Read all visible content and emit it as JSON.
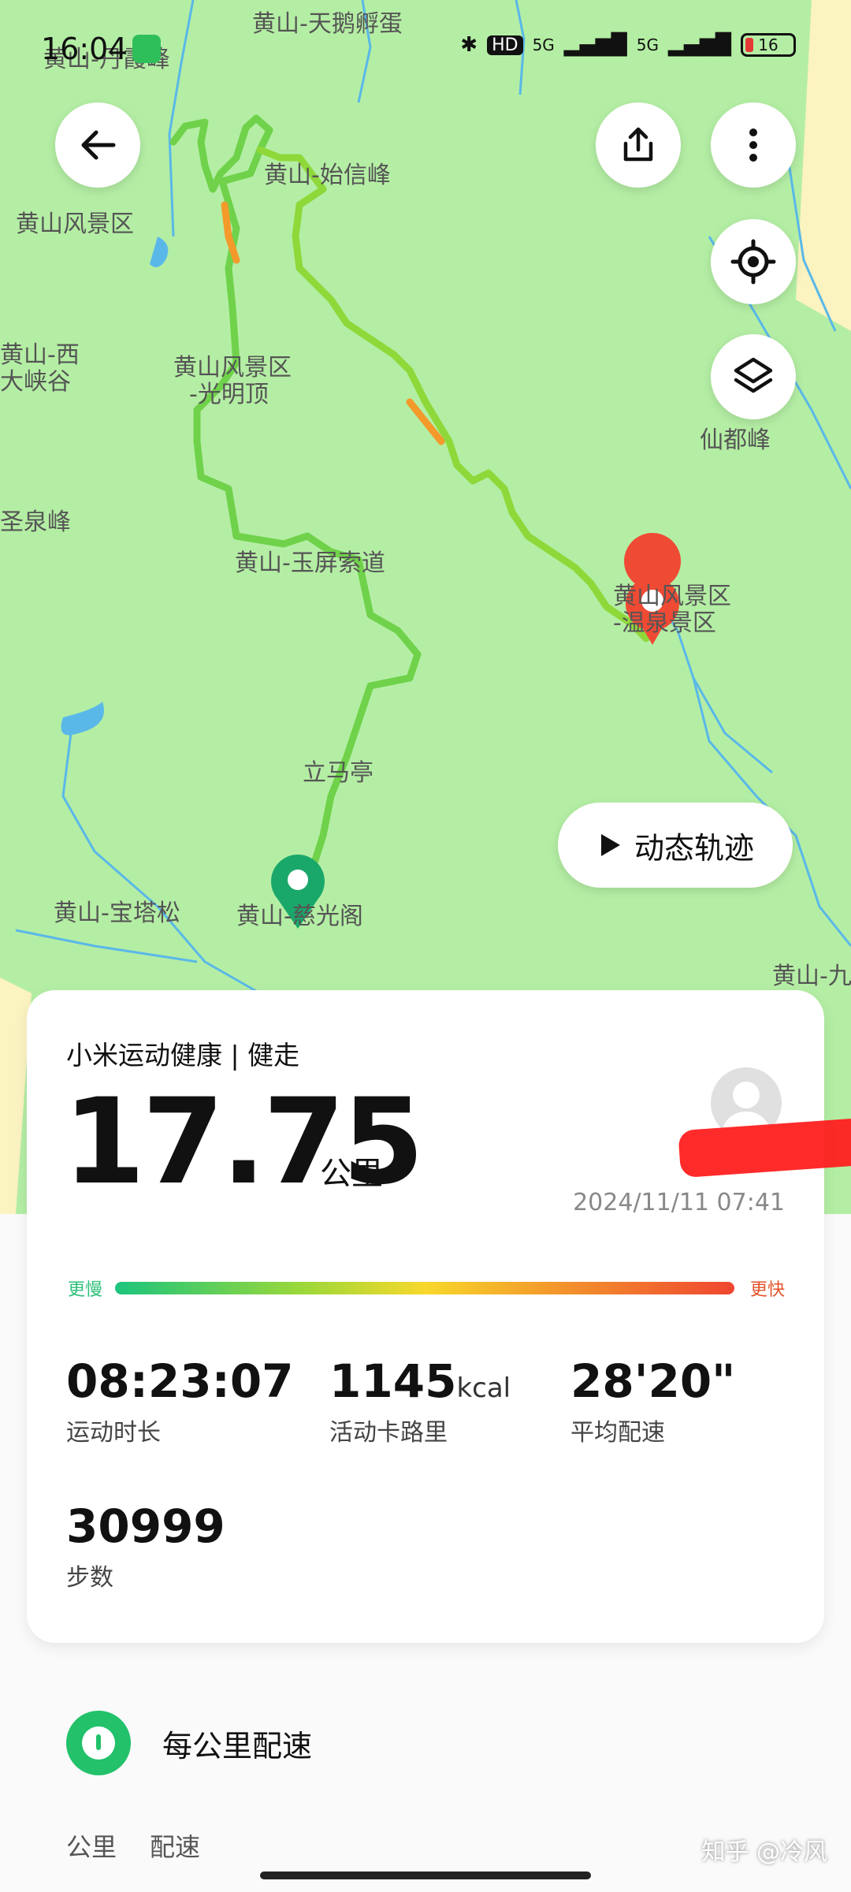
{
  "status_bar": {
    "time": "16:04",
    "network": "5G",
    "network2": "5G",
    "hd_badge": "HD",
    "battery": "16"
  },
  "map": {
    "place_labels": [
      "黄山-天鹅孵蛋",
      "黄山-丹霞峰",
      "黄山-始信峰",
      "黄山风景区",
      "黄山-西",
      "大峡谷",
      "黄山风景区",
      "-光明顶",
      "仙都峰",
      "圣泉峰",
      "黄山-玉屏索道",
      "黄山风景区",
      "-温泉景区",
      "立马亭",
      "黄山-宝塔松",
      "黄山-慈光阁",
      "黄山-九"
    ],
    "play_label": "动态轨迹",
    "icons": [
      "back-arrow-icon",
      "share-icon",
      "more-vertical-icon",
      "locate-icon",
      "layers-icon",
      "play-icon",
      "start-pin-icon",
      "end-pin-icon"
    ],
    "colors": {
      "land": "#b4eea4",
      "water": "#5ab8e8",
      "track_fast": "#ef4630",
      "track_slow": "#1bc47d",
      "end_pin": "#ef4a34",
      "start_pin": "#1aa86a"
    }
  },
  "summary": {
    "app_title": "小米运动健康 | 健走",
    "distance": "17.75",
    "distance_unit": "公里",
    "datetime": "2024/11/11 07:41",
    "legend_slow": "更慢",
    "legend_fast": "更快",
    "stats": [
      {
        "value": "08:23:07",
        "unit": "",
        "label": "运动时长"
      },
      {
        "value": "1145",
        "unit": "kcal",
        "label": "活动卡路里"
      },
      {
        "value": "28'20\"",
        "unit": "",
        "label": "平均配速"
      },
      {
        "value": "30999",
        "unit": "",
        "label": "步数"
      }
    ]
  },
  "splits": {
    "title": "每公里配速",
    "columns": [
      "公里",
      "配速"
    ]
  },
  "watermark": "知乎 @冷风"
}
